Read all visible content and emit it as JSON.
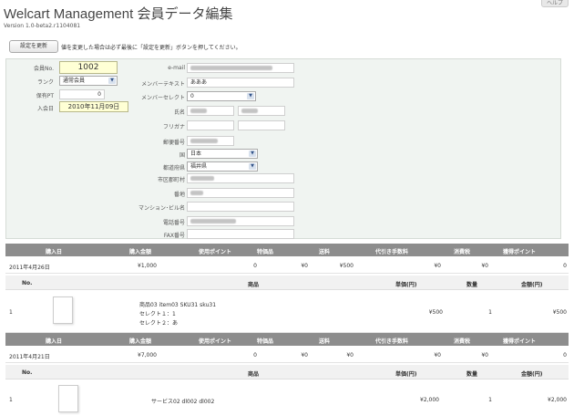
{
  "header": {
    "title": "Welcart Management 会員データ編集",
    "version": "Version 1.0-beta2.r1104081",
    "help_tab": "ヘルプ"
  },
  "toolbar": {
    "update_label": "設定を更新",
    "notice": "値を変更した場合は必ず最後に「設定を更新」ボタンを押してください。"
  },
  "member": {
    "id_label": "会員No.",
    "id_value": "1002",
    "rank_label": "ランク",
    "rank_value": "通常会員",
    "points_label": "保有PT",
    "points_value": "0",
    "joined_label": "入会日",
    "joined_value": "2010年11月09日",
    "email_label": "e-mail",
    "text_label": "メンバーテキスト",
    "text_value": "あああ",
    "select_label": "メンバーセレクト",
    "select_value": "0",
    "name_label": "氏名",
    "furigana_label": "フリガナ",
    "zip_label": "郵便番号",
    "country_label": "国",
    "country_value": "日本",
    "pref_label": "都道府県",
    "pref_value": "福井県",
    "city_label": "市区郡町村",
    "address_label": "番地",
    "building_label": "マンション･ビル名",
    "tel_label": "電話番号",
    "fax_label": "FAX番号"
  },
  "order_columns": [
    "購入日",
    "購入金額",
    "使用ポイント",
    "特価品",
    "送料",
    "代引き手数料",
    "消費税",
    "獲得ポイント"
  ],
  "item_columns": [
    "No.",
    "商品",
    "単価(円)",
    "数量",
    "金額(円)"
  ],
  "orders": [
    {
      "date": "2011年4月26日",
      "amount": "¥1,000",
      "used_points": "0",
      "discount": "¥0",
      "shipping": "¥500",
      "cod_fee": "¥0",
      "tax": "¥0",
      "earned_points": "0",
      "item": {
        "no": "1",
        "name": "商品03 item03 SKU31 sku31",
        "option1": "セレクト１：1",
        "option2": "セレクト２：あ",
        "unit_price": "¥500",
        "qty": "1",
        "total": "¥500"
      }
    },
    {
      "date": "2011年4月21日",
      "amount": "¥7,000",
      "used_points": "0",
      "discount": "¥0",
      "shipping": "¥0",
      "cod_fee": "¥0",
      "tax": "¥0",
      "earned_points": "0",
      "item": {
        "no": "1",
        "name": "サービス02 dl002 dl002",
        "unit_price": "¥2,000",
        "qty": "1",
        "total": "¥2,000"
      }
    }
  ]
}
